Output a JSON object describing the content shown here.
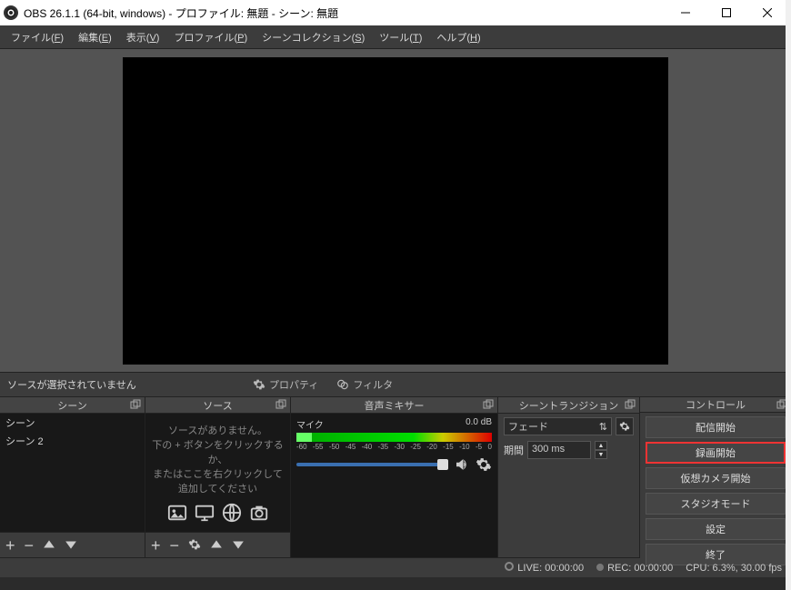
{
  "window": {
    "title": "OBS 26.1.1 (64-bit, windows) - プロファイル: 無題 - シーン: 無題"
  },
  "menu": {
    "file": {
      "label": "ファイル",
      "key": "F"
    },
    "edit": {
      "label": "編集",
      "key": "E"
    },
    "view": {
      "label": "表示",
      "key": "V"
    },
    "profile": {
      "label": "プロファイル",
      "key": "P"
    },
    "scene_collection": {
      "label": "シーンコレクション",
      "key": "S"
    },
    "tools": {
      "label": "ツール",
      "key": "T"
    },
    "help": {
      "label": "ヘルプ",
      "key": "H"
    }
  },
  "source_toolbar": {
    "no_selection": "ソースが選択されていません",
    "properties": "プロパティ",
    "filters": "フィルタ"
  },
  "docks": {
    "scenes": {
      "title": "シーン",
      "items": [
        "シーン",
        "シーン 2"
      ]
    },
    "sources": {
      "title": "ソース",
      "empty_line1": "ソースがありません。",
      "empty_line2": "下の + ボタンをクリックするか、",
      "empty_line3": "またはここを右クリックして追加してください"
    },
    "mixer": {
      "title": "音声ミキサー",
      "channel": "マイク",
      "db": "0.0 dB",
      "ticks": [
        "-60",
        "-55",
        "-50",
        "-45",
        "-40",
        "-35",
        "-30",
        "-25",
        "-20",
        "-15",
        "-10",
        "-5",
        "0"
      ]
    },
    "transitions": {
      "title": "シーントランジション",
      "selected": "フェード",
      "duration_label": "期間",
      "duration_value": "300 ms"
    },
    "controls": {
      "title": "コントロール",
      "start_stream": "配信開始",
      "start_record": "録画開始",
      "start_vcam": "仮想カメラ開始",
      "studio_mode": "スタジオモード",
      "settings": "設定",
      "exit": "終了"
    }
  },
  "status": {
    "live": "LIVE: 00:00:00",
    "rec": "REC: 00:00:00",
    "cpu": "CPU: 6.3%, 30.00 fps"
  }
}
